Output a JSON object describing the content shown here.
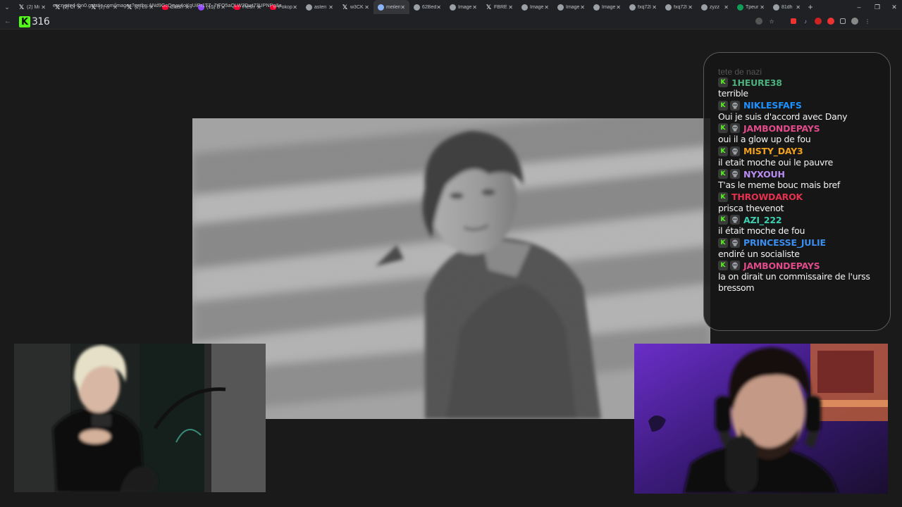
{
  "browser": {
    "tabs": [
      {
        "title": "(2) Mi",
        "icon": "x-icon",
        "color": "#ffffff"
      },
      {
        "title": "(2) Cl",
        "icon": "x-icon",
        "color": "#ffffff"
      },
      {
        "title": "(2) cl",
        "icon": "x-icon",
        "color": "#ffffff"
      },
      {
        "title": "(2) Lo",
        "icon": "x-icon",
        "color": "#ffffff"
      },
      {
        "title": "Clash",
        "icon": "youtube-icon",
        "color": "#ff0033"
      },
      {
        "title": "(15) D",
        "icon": "purple-icon",
        "color": "#9146ff"
      },
      {
        "title": "Flesh",
        "icon": "youtube-icon",
        "color": "#ff0033"
      },
      {
        "title": "Pokop",
        "icon": "youtube-icon",
        "color": "#ff0033"
      },
      {
        "title": "asteri",
        "icon": "globe-icon",
        "color": "#9aa0a6"
      },
      {
        "title": "w3CK",
        "icon": "x-icon",
        "color": "#ffffff"
      },
      {
        "title": "meilen",
        "icon": "google-icon",
        "color": "#8ab4f8"
      },
      {
        "title": "62Bed",
        "icon": "globe-icon",
        "color": "#9aa0a6"
      },
      {
        "title": "Image",
        "icon": "globe-icon",
        "color": "#9aa0a6"
      },
      {
        "title": "FBRE",
        "icon": "x-icon",
        "color": "#ffffff"
      },
      {
        "title": "Image",
        "icon": "globe-icon",
        "color": "#9aa0a6"
      },
      {
        "title": "Image",
        "icon": "globe-icon",
        "color": "#9aa0a6"
      },
      {
        "title": "Image",
        "icon": "globe-icon",
        "color": "#9aa0a6"
      },
      {
        "title": "fxq72l",
        "icon": "globe-icon",
        "color": "#9aa0a6"
      },
      {
        "title": "fxq72l",
        "icon": "globe-icon",
        "color": "#9aa0a6"
      },
      {
        "title": "zyzz",
        "icon": "globe-icon",
        "color": "#9aa0a6"
      },
      {
        "title": "Tpeur",
        "icon": "green-icon",
        "color": "#0f9d58"
      },
      {
        "title": "81dh",
        "icon": "globe-icon",
        "color": "#9aa0a6"
      }
    ],
    "active_tab_index": 10,
    "url": "encrypted-tbn0.gstatic.com/images?q=tbn:ANd9GcQzyw4oKgUiPr1TZ_7tFO5aQLW2Dwt73UPNPg&s",
    "new_tab_label": "+",
    "window_controls": {
      "minimize": "–",
      "restore": "❐",
      "close": "✕"
    }
  },
  "stream": {
    "viewer_count": "316",
    "brand_color": "#53fc18"
  },
  "chat": {
    "faded_top": "tete de nazi",
    "messages": [
      {
        "user": "1HEURE38",
        "color": "#4caf7d",
        "text": "terrible",
        "skull": false
      },
      {
        "user": "NIKLESFAFS",
        "color": "#1e90ff",
        "text": "Oui je suis d'accord avec Dany",
        "skull": true
      },
      {
        "user": "JAMBONDEPAYS",
        "color": "#e04b8a",
        "text": "oui il a glow up de fou",
        "skull": true
      },
      {
        "user": "MISTY_DAY3",
        "color": "#f0a020",
        "text": "il etait moche oui le pauvre",
        "skull": true
      },
      {
        "user": "NYXOUH",
        "color": "#b88cf0",
        "text": "T'as le meme bouc mais bref",
        "skull": true
      },
      {
        "user": "THROWDAROK",
        "color": "#e5304f",
        "text": "prisca thevenot",
        "skull": false
      },
      {
        "user": "AZI_222",
        "color": "#3ecfb0",
        "text": "il était moche de fou",
        "skull": true
      },
      {
        "user": "PRINCESSE_JULIE",
        "color": "#3a8ef0",
        "text": "endiré un socialiste",
        "skull": true
      },
      {
        "user": "JAMBONDEPAYS",
        "color": "#e04b8a",
        "text": "la on dirait un commissaire de l'urss bressom",
        "skull": true
      }
    ]
  }
}
